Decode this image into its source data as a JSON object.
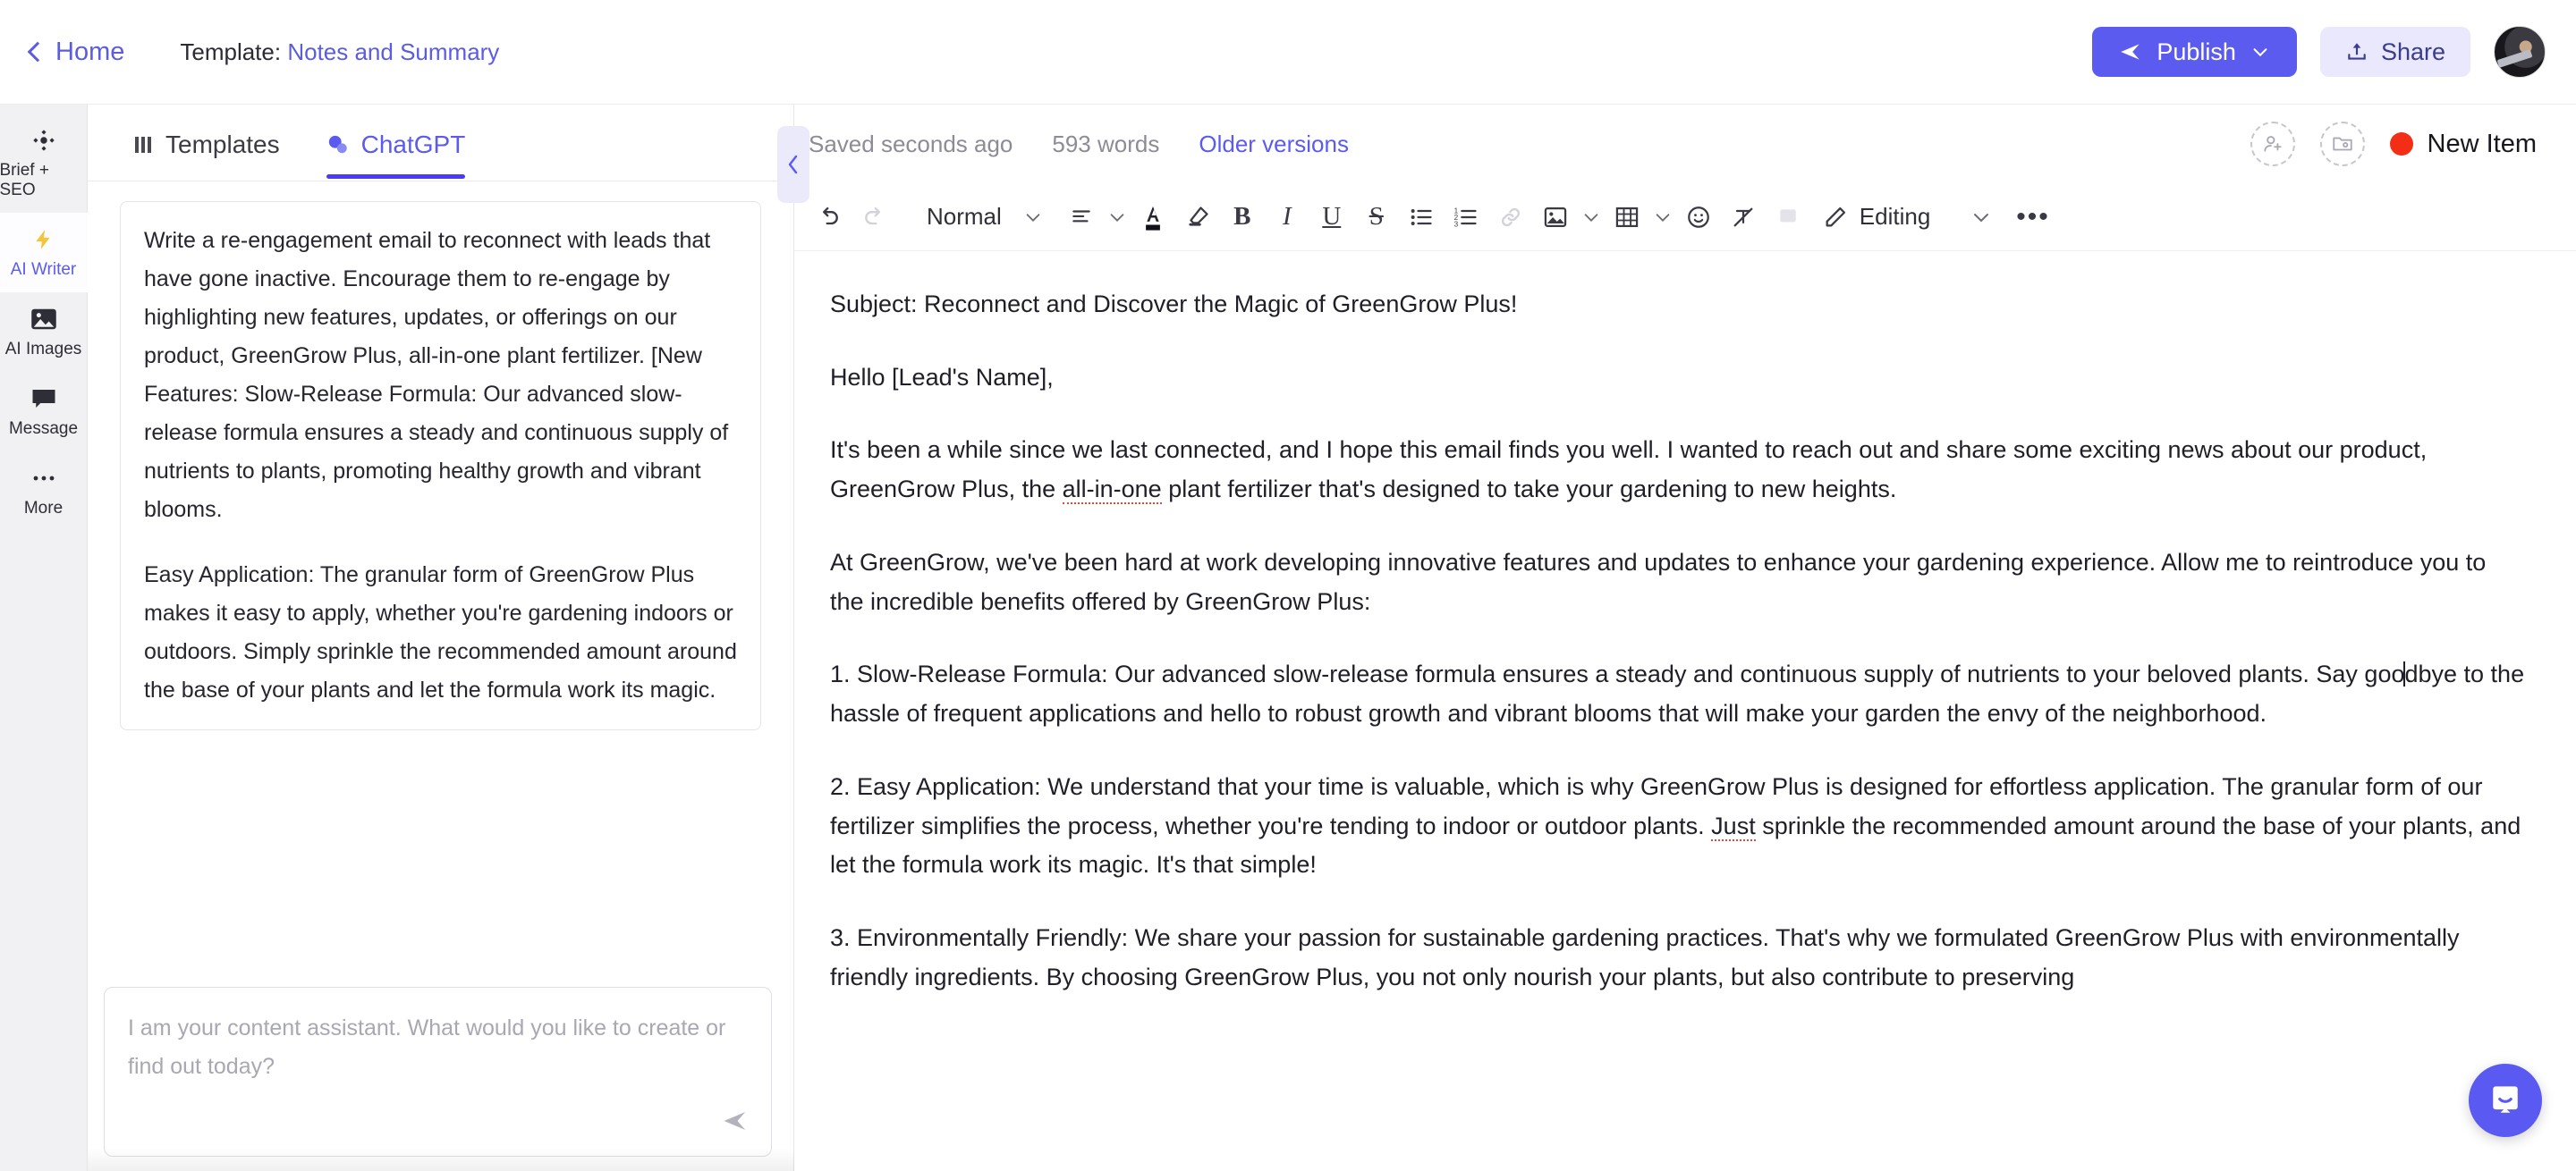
{
  "topbar": {
    "home_label": "Home",
    "template_prefix": "Template:",
    "template_name": "Notes and Summary",
    "publish_label": "Publish",
    "share_label": "Share"
  },
  "rail": {
    "items": [
      {
        "label": "Brief + SEO",
        "icon": "target-icon",
        "active": false
      },
      {
        "label": "AI Writer",
        "icon": "lightning-icon",
        "active": true
      },
      {
        "label": "AI Images",
        "icon": "image-icon",
        "active": false
      },
      {
        "label": "Message",
        "icon": "chat-bubble-icon",
        "active": false
      },
      {
        "label": "More",
        "icon": "ellipsis-icon",
        "active": false
      }
    ]
  },
  "chat": {
    "tabs": [
      {
        "label": "Templates",
        "icon": "grid-icon",
        "active": false
      },
      {
        "label": "ChatGPT",
        "icon": "chat-icon",
        "active": true
      }
    ],
    "message_paragraphs": [
      "Write a re-engagement email to reconnect with leads that have gone inactive. Encourage them to re-engage by highlighting new features, updates, or offerings on our product, GreenGrow Plus, all-in-one plant fertilizer. [New Features: Slow-Release Formula: Our advanced slow-release formula ensures a steady and continuous supply of nutrients to plants, promoting healthy growth and vibrant blooms.",
      "Easy Application: The granular form of GreenGrow Plus makes it easy to apply, whether you're gardening indoors or outdoors. Simply sprinkle the recommended amount around the base of your plants and let the formula work its magic."
    ],
    "input_placeholder": "I am your content assistant. What would you like to create or find out today?",
    "input_value": ""
  },
  "doc_status": {
    "saved_text": "Saved seconds ago",
    "word_count": "593 words",
    "older_versions": "Older versions",
    "new_item_label": "New Item",
    "new_item_color": "#f42d16"
  },
  "toolbar": {
    "style_label": "Normal",
    "editing_label": "Editing"
  },
  "document": {
    "subject": "Subject: Reconnect and Discover the Magic of GreenGrow Plus!",
    "greeting": "Hello [Lead's Name],",
    "p1_a": "It's been a while since we last connected, and I hope this email finds you well. I wanted to reach out and share some exciting news about our product, GreenGrow Plus, the ",
    "p1_err": "all-in-one",
    "p1_b": " plant fertilizer that's designed to take your gardening to new heights.",
    "p2": "At GreenGrow, we've been hard at work developing innovative features and updates to enhance your gardening experience. Allow me to reintroduce you to the incredible benefits offered by GreenGrow Plus:",
    "p3_a": "1. Slow-Release Formula: Our advanced slow-release formula ensures a steady and continuous supply of nutrients to your beloved plants. Say goo",
    "p3_b": "dbye to the hassle of frequent applications and hello to robust growth and vibrant blooms that will make your garden the envy of the neighborhood.",
    "p4_a": "2. Easy Application: We understand that your time is valuable, which is why GreenGrow Plus is designed for effortless application. The granular form of our fertilizer simplifies the process, whether you're tending to indoor or outdoor plants. ",
    "p4_err": "Just",
    "p4_b": " sprinkle the recommended amount around the base of your plants, and let the formula work its magic. It's that simple!",
    "p5": "3. Environmentally Friendly: We share your passion for sustainable gardening practices. That's why we formulated GreenGrow Plus with environmentally friendly ingredients. By choosing GreenGrow Plus, you not only nourish your plants, but also contribute to preserving"
  },
  "colors": {
    "accent": "#5b5bf0",
    "publish_bg": "#5b5bf0",
    "share_bg": "#e9e8fd"
  }
}
